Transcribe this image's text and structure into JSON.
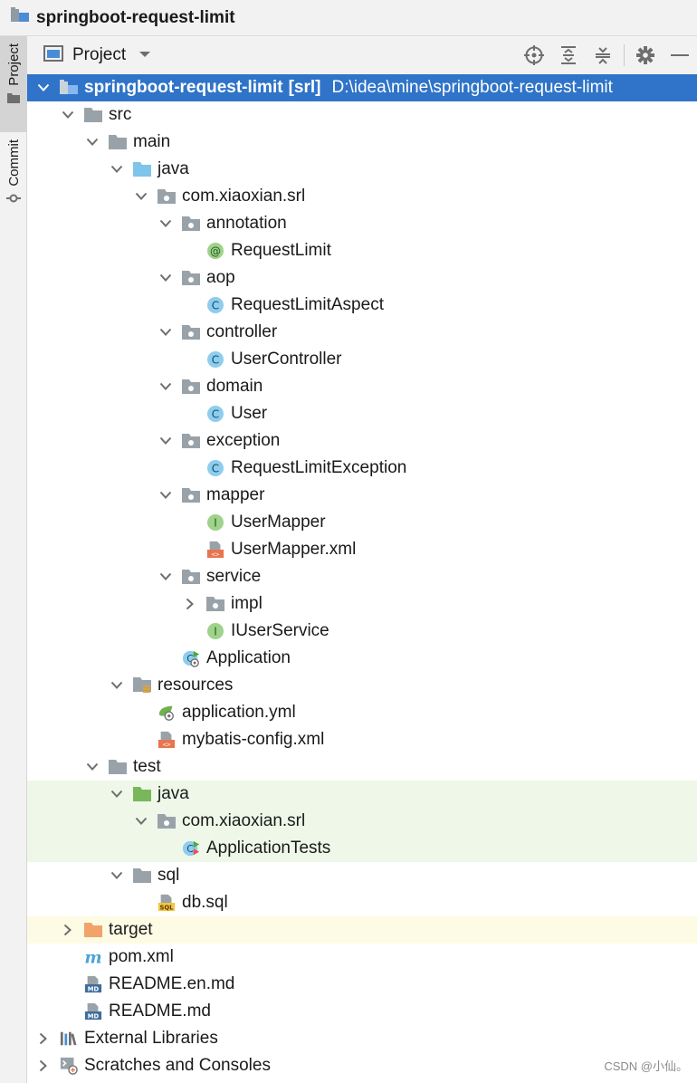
{
  "window": {
    "title": "springboot-request-limit"
  },
  "left_strip": {
    "tabs": [
      "Project",
      "Commit"
    ]
  },
  "tool_window": {
    "title": "Project"
  },
  "tree": [
    {
      "depth": 0,
      "chevron": "down",
      "icon": "module",
      "label": "springboot-request-limit",
      "label_bold": true,
      "tag": "[srl]",
      "path": "D:\\idea\\mine\\springboot-request-limit",
      "selected": true
    },
    {
      "depth": 1,
      "chevron": "down",
      "icon": "folder-gray",
      "label": "src"
    },
    {
      "depth": 2,
      "chevron": "down",
      "icon": "folder-gray",
      "label": "main"
    },
    {
      "depth": 3,
      "chevron": "down",
      "icon": "folder-blue",
      "label": "java"
    },
    {
      "depth": 4,
      "chevron": "down",
      "icon": "package",
      "label": "com.xiaoxian.srl"
    },
    {
      "depth": 5,
      "chevron": "down",
      "icon": "package",
      "label": "annotation"
    },
    {
      "depth": 6,
      "chevron": "none",
      "icon": "annotation",
      "label": "RequestLimit"
    },
    {
      "depth": 5,
      "chevron": "down",
      "icon": "package",
      "label": "aop"
    },
    {
      "depth": 6,
      "chevron": "none",
      "icon": "class",
      "label": "RequestLimitAspect"
    },
    {
      "depth": 5,
      "chevron": "down",
      "icon": "package",
      "label": "controller"
    },
    {
      "depth": 6,
      "chevron": "none",
      "icon": "class",
      "label": "UserController"
    },
    {
      "depth": 5,
      "chevron": "down",
      "icon": "package",
      "label": "domain"
    },
    {
      "depth": 6,
      "chevron": "none",
      "icon": "class",
      "label": "User"
    },
    {
      "depth": 5,
      "chevron": "down",
      "icon": "package",
      "label": "exception"
    },
    {
      "depth": 6,
      "chevron": "none",
      "icon": "class",
      "label": "RequestLimitException"
    },
    {
      "depth": 5,
      "chevron": "down",
      "icon": "package",
      "label": "mapper"
    },
    {
      "depth": 6,
      "chevron": "none",
      "icon": "interface",
      "label": "UserMapper"
    },
    {
      "depth": 6,
      "chevron": "none",
      "icon": "xml",
      "label": "UserMapper.xml"
    },
    {
      "depth": 5,
      "chevron": "down",
      "icon": "package",
      "label": "service"
    },
    {
      "depth": 6,
      "chevron": "right",
      "icon": "package",
      "label": "impl"
    },
    {
      "depth": 6,
      "chevron": "none",
      "icon": "interface",
      "label": "IUserService"
    },
    {
      "depth": 5,
      "chevron": "none",
      "icon": "spring-app",
      "label": "Application"
    },
    {
      "depth": 3,
      "chevron": "down",
      "icon": "resources",
      "label": "resources"
    },
    {
      "depth": 4,
      "chevron": "none",
      "icon": "yml",
      "label": "application.yml"
    },
    {
      "depth": 4,
      "chevron": "none",
      "icon": "xml",
      "label": "mybatis-config.xml"
    },
    {
      "depth": 2,
      "chevron": "down",
      "icon": "folder-gray",
      "label": "test"
    },
    {
      "depth": 3,
      "chevron": "down",
      "icon": "folder-green",
      "label": "java",
      "bg": "test"
    },
    {
      "depth": 4,
      "chevron": "down",
      "icon": "package",
      "label": "com.xiaoxian.srl",
      "bg": "test"
    },
    {
      "depth": 5,
      "chevron": "none",
      "icon": "test-class",
      "label": "ApplicationTests",
      "bg": "test"
    },
    {
      "depth": 3,
      "chevron": "down",
      "icon": "folder-gray",
      "label": "sql"
    },
    {
      "depth": 4,
      "chevron": "none",
      "icon": "sql",
      "label": "db.sql"
    },
    {
      "depth": 1,
      "chevron": "right",
      "icon": "folder-orange",
      "label": "target",
      "bg": "excluded"
    },
    {
      "depth": 1,
      "chevron": "none",
      "icon": "maven",
      "label": "pom.xml"
    },
    {
      "depth": 1,
      "chevron": "none",
      "icon": "md",
      "label": "README.en.md"
    },
    {
      "depth": 1,
      "chevron": "none",
      "icon": "md",
      "label": "README.md"
    },
    {
      "depth": 0,
      "chevron": "right",
      "icon": "libraries",
      "label": "External Libraries"
    },
    {
      "depth": 0,
      "chevron": "right",
      "icon": "scratches",
      "label": "Scratches and Consoles"
    }
  ],
  "watermark": "CSDN @小仙。",
  "colors": {
    "selection": "#2f74c8",
    "test_bg": "#eef7e8",
    "excluded_bg": "#fdfbe3"
  }
}
